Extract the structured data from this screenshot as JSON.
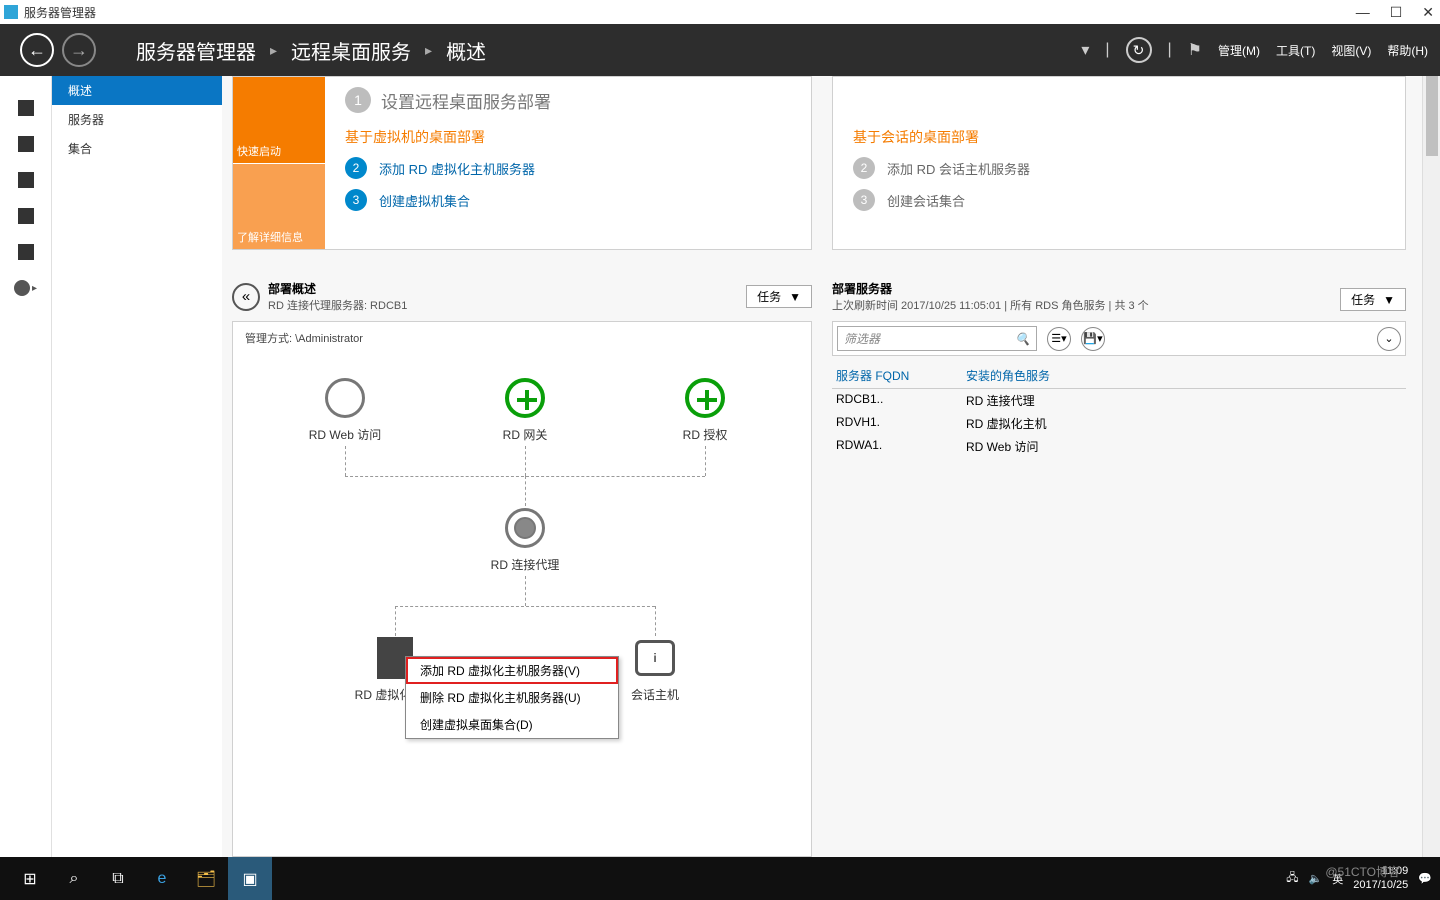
{
  "titlebar": {
    "title": "服务器管理器"
  },
  "header": {
    "breadcrumb": [
      "服务器管理器",
      "远程桌面服务",
      "概述"
    ],
    "menus": {
      "manage": "管理(M)",
      "tools": "工具(T)",
      "view": "视图(V)",
      "help": "帮助(H)"
    }
  },
  "sidebar": {
    "items": [
      "概述",
      "服务器",
      "集合"
    ],
    "selected": 0
  },
  "wizard": {
    "step1": "设置远程桌面服务部署",
    "quickstart": "快速启动",
    "learnmore": "了解详细信息",
    "vm_title": "基于虚拟机的桌面部署",
    "vm_step2": "添加 RD 虚拟化主机服务器",
    "vm_step3": "创建虚拟机集合",
    "session_title": "基于会话的桌面部署",
    "session_step2": "添加 RD 会话主机服务器",
    "session_step3": "创建会话集合"
  },
  "deploy": {
    "title": "部署概述",
    "sub": "RD 连接代理服务器: RDCB1",
    "tasks": "任务",
    "manage": "管理方式:           \\Administrator",
    "nodes": {
      "web": "RD Web 访问",
      "gateway": "RD 网关",
      "license": "RD 授权",
      "broker": "RD 连接代理",
      "vhost": "RD 虚拟化主机",
      "shost": "会话主机"
    }
  },
  "ctxmenu": {
    "add": "添加 RD 虚拟化主机服务器(V)",
    "del": "删除 RD 虚拟化主机服务器(U)",
    "create": "创建虚拟桌面集合(D)"
  },
  "servers": {
    "title": "部署服务器",
    "sub": "上次刷新时间 2017/10/25 11:05:01 | 所有 RDS 角色服务 | 共 3 个",
    "tasks": "任务",
    "filter": "筛选器",
    "col1": "服务器 FQDN",
    "col2": "安装的角色服务",
    "rows": [
      {
        "fqdn": "RDCB1..",
        "role": "RD 连接代理"
      },
      {
        "fqdn": "RDVH1.",
        "role": "RD 虚拟化主机"
      },
      {
        "fqdn": "RDWA1.",
        "role": "RD Web 访问"
      }
    ]
  },
  "tray": {
    "ime": "英",
    "time": "11:09",
    "date": "2017/10/25",
    "watermark": "@51CTO博客"
  }
}
